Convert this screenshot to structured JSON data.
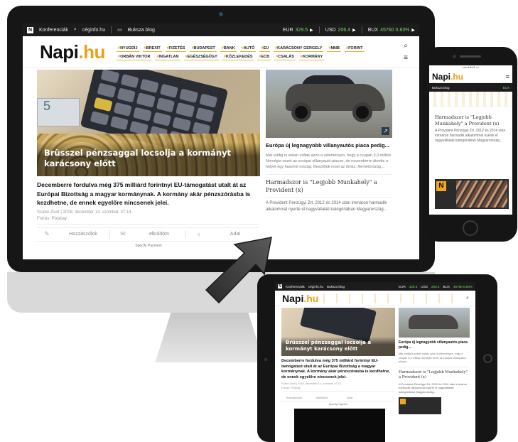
{
  "topbar": {
    "konferenciak": "Konferenciák",
    "ceginfo": "céginfo.hu",
    "bukszablog": "Buksza blog",
    "eur_label": "EUR",
    "eur_value": "329.5",
    "usd_label": "USD",
    "usd_value": "206.4",
    "bux_label": "BUX",
    "bux_value": "45760 0.83%"
  },
  "logo": {
    "name": "Napi",
    "tld": ".hu"
  },
  "tags": [
    "NYUGDÍJ",
    "BREXIT",
    "FIZETÉS",
    "BUDAPEST",
    "BANK",
    "AUTÓ",
    "EU",
    "KARÁCSONY GERGELY",
    "MNB",
    "FORINT",
    "ORBÁN VIKTOR",
    "INGATLAN",
    "EGÉSZSÉGÜGY",
    "KÖZLEKEDÉS",
    "ECB",
    "CSALÁS",
    "KORMÁNY"
  ],
  "lead": {
    "title": "Brüsszel pénzsaggal locsolja a kormányt karácsony előtt",
    "summary": "Decemberre fordulva még 375 milliárd forintnyi EU-támogatást utalt át az Európai Bizottság a magyar kormánynak. A kormány akár pénzszórásba is kezdhetne, de ennek egyelőre nincsenek jelei.",
    "byline": "Szabó Zsolt | 2018. december 14. szombat, 07:14",
    "source": "Forrás: Pixabay"
  },
  "share": {
    "comment": "Hozzászólok",
    "send": "elküldöm",
    "more": "Adat"
  },
  "adlabel": "Specify Payment",
  "side": {
    "title": "Európa új legnagyobb villanyautós piaca pedig...",
    "text": "Már eddig is sokan voltak azon a véleményen, hogy a csupán 5,3 milliós Norvégia vezet az európai villanyautó-piacon, de novemberre átvette a helyét egy hasonló ország. Beszéljük most az öröks, Németország...",
    "title2": "Harmadszor is \"Legjobb Munkahely\" a Provident (x)",
    "text2": "A Provident Pénzügyi Zrt. 2012 és 2014 után immáron harmadik alkalommal nyerte el nagyvállalati kategóriában Magyarország..."
  },
  "phone": {
    "bar_left": "Buksza blog",
    "bar_right": "BUX",
    "title": "Harmadszor is \"Legjobb Munkahely\" a Provident (x)",
    "text": "A Provident Pénzügyi Zrt. 2012 és 2014 után immáron harmadik alkalommal nyerte el nagyvállalati kategóriában Magyarország..."
  },
  "tablet": {
    "lead_title": "Brüsszel pénzsaggal locsolja a kormányt karácsony előtt",
    "summary": "Decemberre fordulva még 375 milliárd forintnyi EU-támogatást utalt át az Európai Bizottság a magyar kormánynak. A kormány akár pénzszórásba is kezdhetne, de ennek egyelőre nincsenek jelei.",
    "side_title": "Európa új legnagyobb villanyautós piaca pedig...",
    "side_text": "Már eddig is sokan voltak azon a véleményen, hogy a csupán 5,3 milliós Norvégia vezet az európai villanyautó-piacon...",
    "side2_title": "Harmadszor is \"Legjobb Munkahely\" a Provident (x)",
    "side2_text": "A Provident Pénzügyi Zrt. 2012 és 2014 után immáron harmadik alkalommal nyerte el nagyvállalati kategóriában Magyarország..."
  },
  "colors": {
    "accent": "#e8a21a",
    "dark": "#1c1c1c",
    "up": "#7dd36a"
  }
}
